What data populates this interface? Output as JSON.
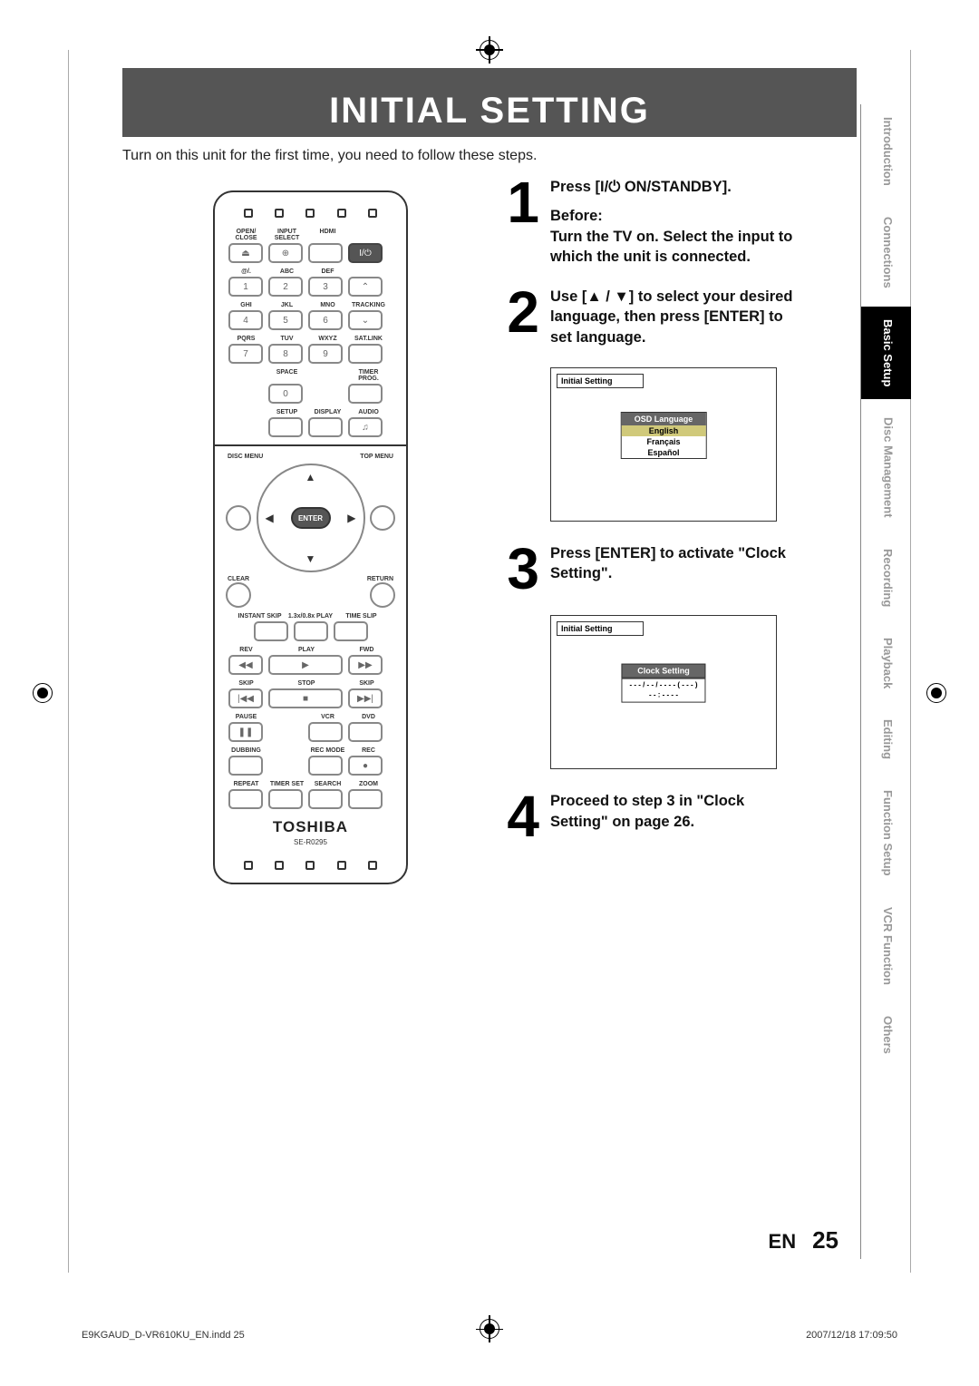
{
  "title": "INITIAL SETTING",
  "intro": "Turn on this unit for the first time, you need to follow these steps.",
  "steps": [
    {
      "num": "1",
      "lines": [
        "Press [I/⏻ ON/STANDBY].",
        "Before:",
        "Turn the TV on. Select the input to which the unit is connected."
      ]
    },
    {
      "num": "2",
      "lines": [
        "Use [▲ / ▼] to select your desired language, then press [ENTER] to set language."
      ],
      "osd": {
        "tab": "Initial Setting",
        "header": "OSD Language",
        "options": [
          "English",
          "Français",
          "Español"
        ],
        "highlight": 0
      }
    },
    {
      "num": "3",
      "lines": [
        "Press [ENTER] to activate \"Clock Setting\"."
      ],
      "osd_clock": {
        "tab": "Initial Setting",
        "header": "Clock Setting",
        "value_line1": "- - - / - - / - - - -  ( - - - )",
        "value_line2": "- -  :  - -  - -"
      }
    },
    {
      "num": "4",
      "lines": [
        "Proceed to step 3 in \"Clock Setting\" on page 26."
      ]
    }
  ],
  "remote": {
    "row1_labels": [
      "OPEN/\nCLOSE",
      "INPUT\nSELECT",
      "HDMI",
      ""
    ],
    "row1_icons": [
      "⏏",
      "⊕",
      "",
      "I/⏻"
    ],
    "row2_labels": [
      "@/.",
      "ABC",
      "DEF",
      ""
    ],
    "row2_nums": [
      "1",
      "2",
      "3"
    ],
    "row2_ch": "⌃",
    "row3_labels": [
      "GHI",
      "JKL",
      "MNO",
      "TRACKING"
    ],
    "row3_nums": [
      "4",
      "5",
      "6"
    ],
    "row3_ch": "⌄",
    "row4_labels": [
      "PQRS",
      "TUV",
      "WXYZ",
      "SAT.LINK"
    ],
    "row4_nums": [
      "7",
      "8",
      "9"
    ],
    "row5_labels": [
      "",
      "SPACE",
      "",
      "TIMER\nPROG."
    ],
    "row5_center": "0",
    "row6_labels": [
      "",
      "SETUP",
      "DISPLAY",
      "AUDIO"
    ],
    "disc_menu": "DISC MENU",
    "top_menu": "TOP MENU",
    "enter": "ENTER",
    "clear": "CLEAR",
    "return": "RETURN",
    "instant_skip": "INSTANT\nSKIP",
    "play_speed": "1.3x/0.8x\nPLAY",
    "time_slip": "TIME SLIP",
    "rev": "REV",
    "play": "PLAY",
    "fwd": "FWD",
    "skip_l": "SKIP",
    "stop": "STOP",
    "skip_r": "SKIP",
    "pause": "PAUSE",
    "vcr": "VCR",
    "dvd": "DVD",
    "dubbing": "DUBBING",
    "rec_mode": "REC MODE",
    "rec": "REC",
    "repeat": "REPEAT",
    "timer_set": "TIMER SET",
    "search": "SEARCH",
    "zoom": "ZOOM",
    "brand": "TOSHIBA",
    "model": "SE-R0295"
  },
  "side_tabs": [
    "Introduction",
    "Connections",
    "Basic Setup",
    "Disc Management",
    "Recording",
    "Playback",
    "Editing",
    "Function Setup",
    "VCR Function",
    "Others"
  ],
  "active_tab_index": 2,
  "footer": {
    "lang": "EN",
    "page": "25"
  },
  "print": {
    "left": "E9KGAUD_D-VR610KU_EN.indd   25",
    "right": "2007/12/18   17:09:50"
  }
}
